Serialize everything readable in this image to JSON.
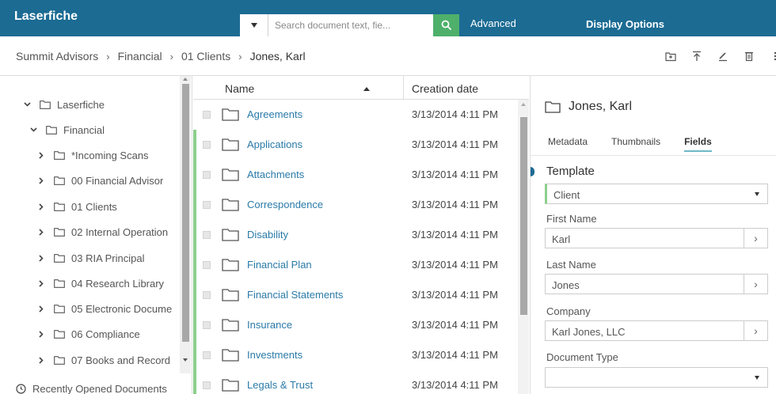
{
  "app": {
    "title": "Laserfiche"
  },
  "search": {
    "placeholder": "Search document text, fie...",
    "advanced_label": "Advanced",
    "display_options_label": "Display Options"
  },
  "breadcrumb": [
    "Summit Advisors",
    "Financial",
    "01 Clients",
    "Jones, Karl"
  ],
  "toolbar": {
    "icons": [
      "new-folder-icon",
      "upload-icon",
      "edit-icon",
      "delete-icon",
      "more-icon"
    ]
  },
  "tree": {
    "nodes": [
      {
        "label": "Laserfiche",
        "expanded": true,
        "level": 0
      },
      {
        "label": "Financial",
        "expanded": true,
        "level": 1
      },
      {
        "label": "*Incoming Scans",
        "expanded": false,
        "level": 2
      },
      {
        "label": "00 Financial Advisor",
        "expanded": false,
        "level": 2
      },
      {
        "label": "01 Clients",
        "expanded": false,
        "level": 2
      },
      {
        "label": "02 Internal Operation",
        "expanded": false,
        "level": 2
      },
      {
        "label": "03 RIA Principal",
        "expanded": false,
        "level": 2
      },
      {
        "label": "04 Research Library",
        "expanded": false,
        "level": 2
      },
      {
        "label": "05 Electronic Docume",
        "expanded": false,
        "level": 2
      },
      {
        "label": "06 Compliance",
        "expanded": false,
        "level": 2
      },
      {
        "label": "07 Books and Record",
        "expanded": false,
        "level": 2
      }
    ],
    "recent_label": "Recently Opened Documents"
  },
  "list": {
    "columns": {
      "name": "Name",
      "date": "Creation date"
    },
    "rows": [
      {
        "name": "Agreements",
        "date": "3/13/2014 4:11 PM"
      },
      {
        "name": "Applications",
        "date": "3/13/2014 4:11 PM"
      },
      {
        "name": "Attachments",
        "date": "3/13/2014 4:11 PM"
      },
      {
        "name": "Correspondence",
        "date": "3/13/2014 4:11 PM"
      },
      {
        "name": "Disability",
        "date": "3/13/2014 4:11 PM"
      },
      {
        "name": "Financial Plan",
        "date": "3/13/2014 4:11 PM"
      },
      {
        "name": "Financial Statements",
        "date": "3/13/2014 4:11 PM"
      },
      {
        "name": "Insurance",
        "date": "3/13/2014 4:11 PM"
      },
      {
        "name": "Investments",
        "date": "3/13/2014 4:11 PM"
      },
      {
        "name": "Legals & Trust",
        "date": "3/13/2014 4:11 PM"
      }
    ]
  },
  "panel": {
    "title": "Jones, Karl",
    "tabs": [
      "Metadata",
      "Thumbnails",
      "Fields"
    ],
    "active_tab": "Fields",
    "template_label": "Template",
    "template_value": "Client",
    "fields": [
      {
        "label": "First Name",
        "value": "Karl"
      },
      {
        "label": "Last Name",
        "value": "Jones"
      },
      {
        "label": "Company",
        "value": "Karl Jones, LLC"
      }
    ],
    "document_type_label": "Document Type",
    "document_type_value": ""
  },
  "colors": {
    "header": "#1b6b93",
    "search_button": "#4eb06b",
    "link": "#2a7aa8",
    "row_marker": "#8ccf8c"
  }
}
